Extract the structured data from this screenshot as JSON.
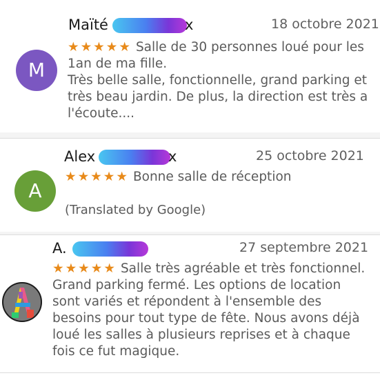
{
  "reviews": [
    {
      "initial": "M",
      "avatar_color": "#7b57c1",
      "name_visible": "Maïté",
      "name_tail": "x",
      "date": "18 octobre 2021",
      "stars": "★★★★★",
      "rating": 5,
      "text": "Salle de 30 personnes loué pour les 1an de ma fille.\nTrès belle salle, fonctionnelle, grand parking et très beau jardin. De plus, la direction est très a l'écoute...."
    },
    {
      "initial": "A",
      "avatar_color": "#689f38",
      "name_visible": "Alex",
      "name_tail": "x",
      "date": "25 octobre 2021",
      "stars": "★★★★★",
      "rating": 5,
      "text": "Bonne salle de réception",
      "translation_note": "(Translated by Google)"
    },
    {
      "initial": "A",
      "avatar_style": "colorful-letter-A",
      "name_visible": "A.",
      "date": "27 septembre 2021",
      "stars": "★★★★★",
      "rating": 5,
      "text": "Salle très agréable et très fonctionnel. Grand parking fermé. Les options de location sont variés et répondent à l'ensemble des besoins pour tout type de fête. Nous avons déjà loué les salles à plusieurs reprises et à chaque fois ce fut magique."
    }
  ],
  "colors": {
    "star": "#e88a1a",
    "redaction_gradient": [
      "#49c6f0",
      "#4a7ff0",
      "#7a36d8",
      "#b638d8"
    ]
  }
}
